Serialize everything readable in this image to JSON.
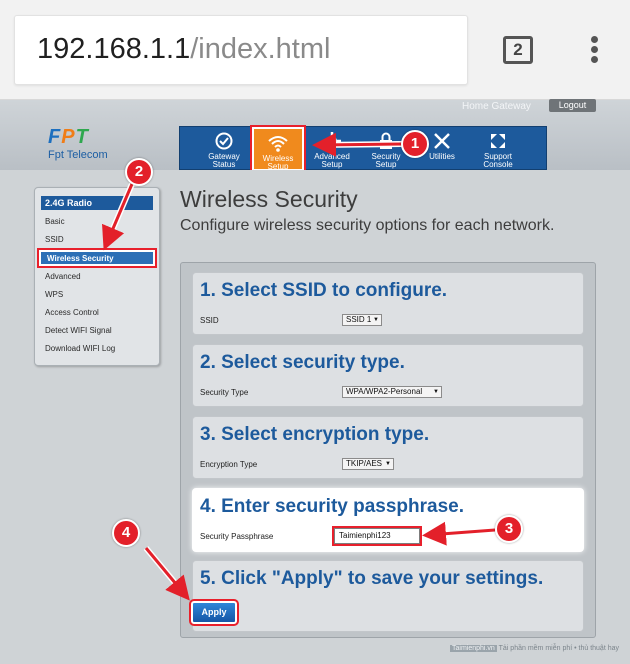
{
  "browser": {
    "url_host": "192.168.1.1",
    "url_path": "/index.html",
    "tab_count": "2"
  },
  "header": {
    "home_gateway": "Home Gateway",
    "logout": "Logout",
    "logo_mark": "FPT",
    "logo_text": "Fpt Telecom"
  },
  "nav": [
    {
      "line1": "Gateway",
      "line2": "Status",
      "icon": "gauge-icon"
    },
    {
      "line1": "Wireless",
      "line2": "Setup",
      "icon": "wifi-icon"
    },
    {
      "line1": "Advanced",
      "line2": "Setup",
      "icon": "gear-icon"
    },
    {
      "line1": "Security",
      "line2": "Setup",
      "icon": "lock-icon"
    },
    {
      "line1": "Utilities",
      "line2": "",
      "icon": "tools-icon"
    },
    {
      "line1": "Support",
      "line2": "Console",
      "icon": "support-icon"
    }
  ],
  "sidebar": {
    "heading": "2.4G Radio",
    "items": [
      "Basic",
      "SSID",
      "Wireless Security",
      "Advanced",
      "WPS",
      "Access Control",
      "Detect WIFI Signal",
      "Download WIFI Log"
    ]
  },
  "main": {
    "title": "Wireless Security",
    "subtitle": "Configure wireless security options for each network."
  },
  "steps": {
    "s1_title": "1. Select SSID to configure.",
    "s1_label": "SSID",
    "s1_value": "SSID 1",
    "s2_title": "2. Select security type.",
    "s2_label": "Security Type",
    "s2_value": "WPA/WPA2-Personal",
    "s3_title": "3. Select encryption type.",
    "s3_label": "Encryption Type",
    "s3_value": "TKIP/AES",
    "s4_title": "4. Enter security passphrase.",
    "s4_label": "Security Passphrase",
    "s4_value": "Taimienphi123",
    "s5_title": "5. Click \"Apply\" to save your settings.",
    "apply": "Apply"
  },
  "callouts": [
    "1",
    "2",
    "3",
    "4"
  ],
  "colors": {
    "accent": "#1d5a9c",
    "highlight": "#e3202a",
    "active_nav": "#f08a1d"
  },
  "watermark": {
    "brand": "Taimienphi.vn",
    "text": "Tải phần mềm miễn phí • thủ thuật hay"
  }
}
